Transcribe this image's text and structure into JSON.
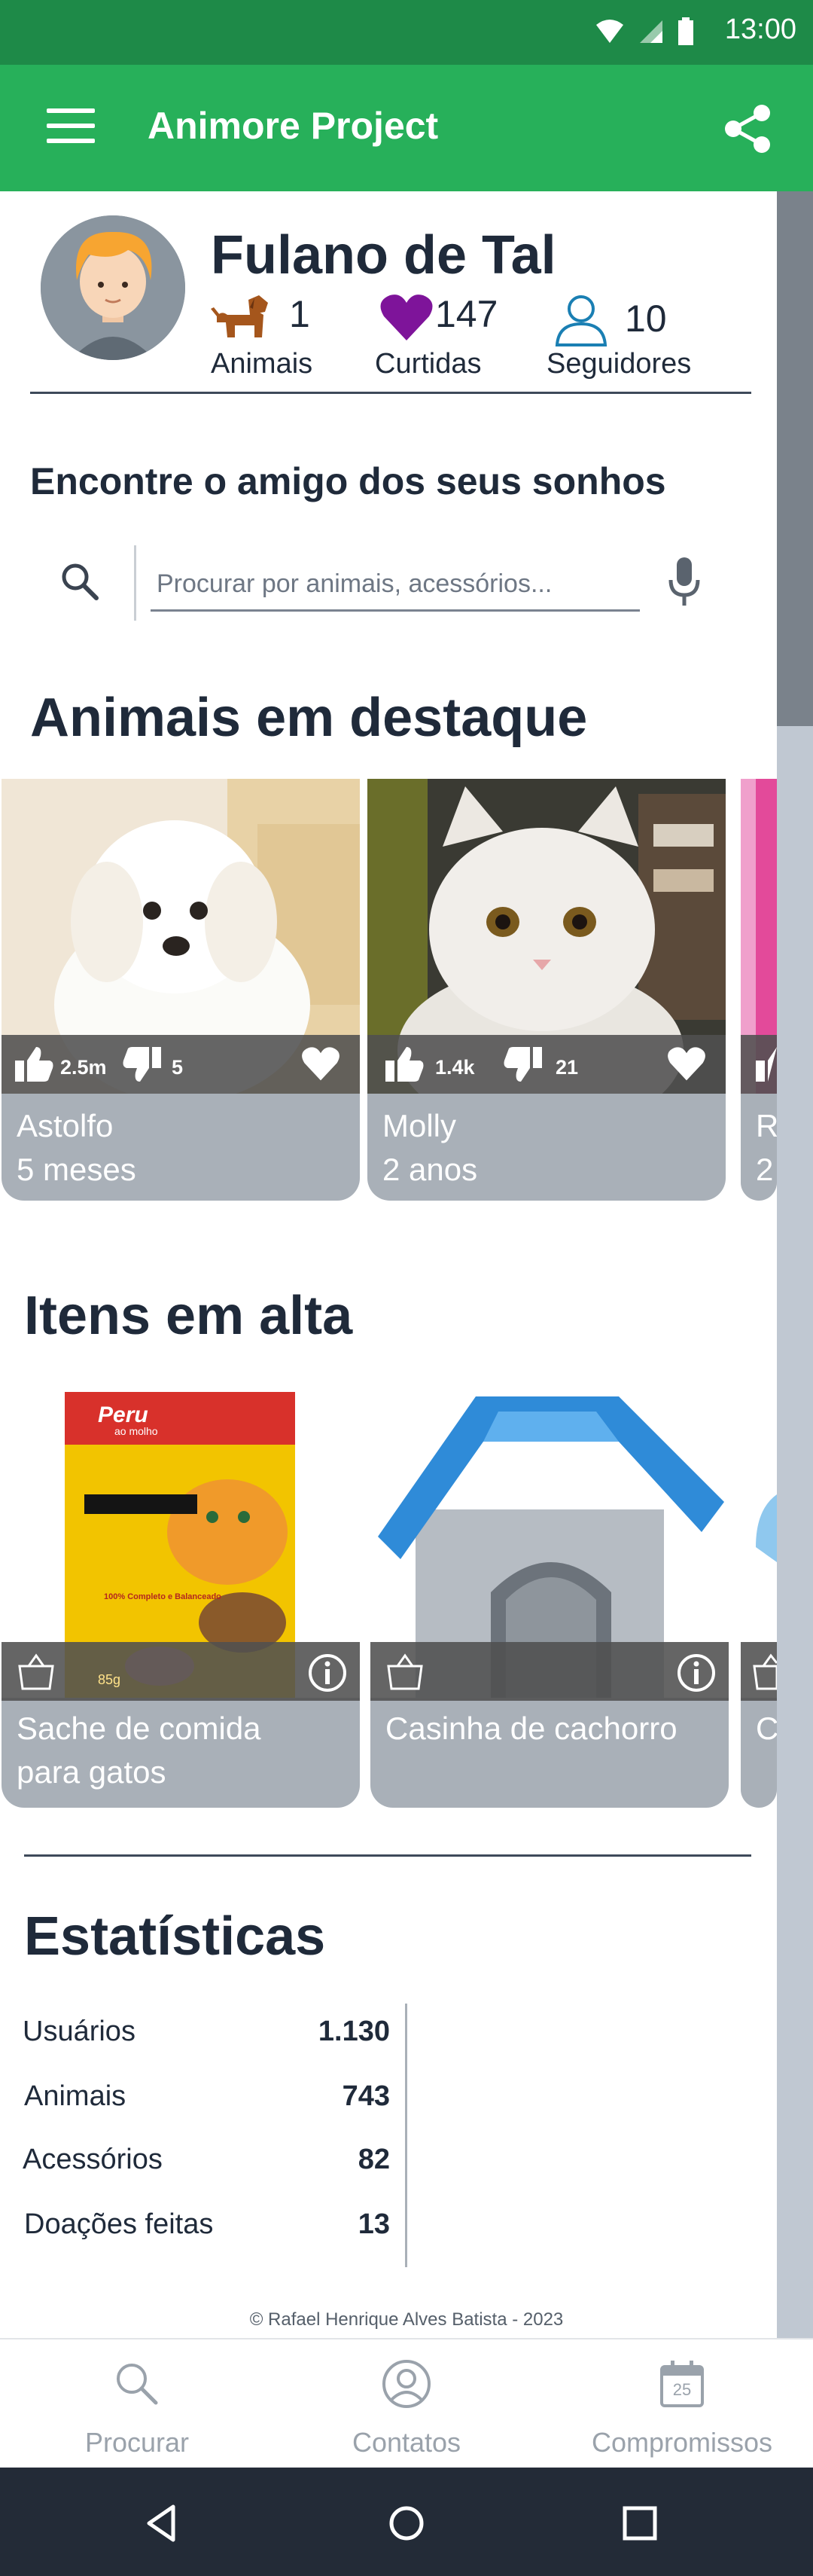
{
  "status_bar": {
    "time": "13:00"
  },
  "app_bar": {
    "title": "Animore Project",
    "menu_icon": "menu-icon",
    "share_icon": "share-icon"
  },
  "profile": {
    "name": "Fulano de Tal",
    "stats": [
      {
        "icon": "dog-icon",
        "value": "1",
        "label": "Animais"
      },
      {
        "icon": "heart-icon",
        "value": "147",
        "label": "Curtidas"
      },
      {
        "icon": "person-icon",
        "value": "10",
        "label": "Seguidores"
      }
    ]
  },
  "search": {
    "heading": "Encontre o amigo dos seus sonhos",
    "placeholder": "Procurar por animais, acessórios..."
  },
  "featured": {
    "title": "Animais em destaque",
    "cards": [
      {
        "likes": "2.5m",
        "dislikes": "5",
        "name": "Astolfo",
        "age": "5 meses"
      },
      {
        "likes": "1.4k",
        "dislikes": "21",
        "name": "Molly",
        "age": "2 anos"
      },
      {
        "name": "R",
        "age": "2"
      }
    ]
  },
  "trending": {
    "title": "Itens em alta",
    "items": [
      {
        "name_line1": "Sache de comida",
        "name_line2": "para gatos",
        "package_brand": "Peru",
        "package_sub": "ao molho",
        "package_weight": "85g",
        "package_note": "100% Completo e Balanceado"
      },
      {
        "name_line1": "Casinha de cachorro",
        "name_line2": ""
      },
      {
        "name_line1": "C",
        "name_line2": ""
      }
    ]
  },
  "statistics": {
    "title": "Estatísticas",
    "rows": [
      {
        "label": "Usuários",
        "value": "1.130"
      },
      {
        "label": "Animais",
        "value": "743"
      },
      {
        "label": "Acessórios",
        "value": "82"
      },
      {
        "label": "Doações feitas",
        "value": "13"
      }
    ]
  },
  "footer": {
    "copyright": "© Rafael Henrique Alves Batista - 2023"
  },
  "bottom_nav": {
    "items": [
      {
        "label": "Procurar",
        "icon": "search-icon"
      },
      {
        "label": "Contatos",
        "icon": "contact-icon"
      },
      {
        "label": "Compromissos",
        "icon": "calendar-icon",
        "calendar_day": "25"
      }
    ]
  },
  "colors": {
    "status_bar": "#1e8a48",
    "app_bar": "#27b05a",
    "text_dark": "#1f2a3a",
    "card_bg": "#a9b0b8",
    "nav_inactive": "#9aa2ab",
    "system_nav": "#232b37"
  }
}
